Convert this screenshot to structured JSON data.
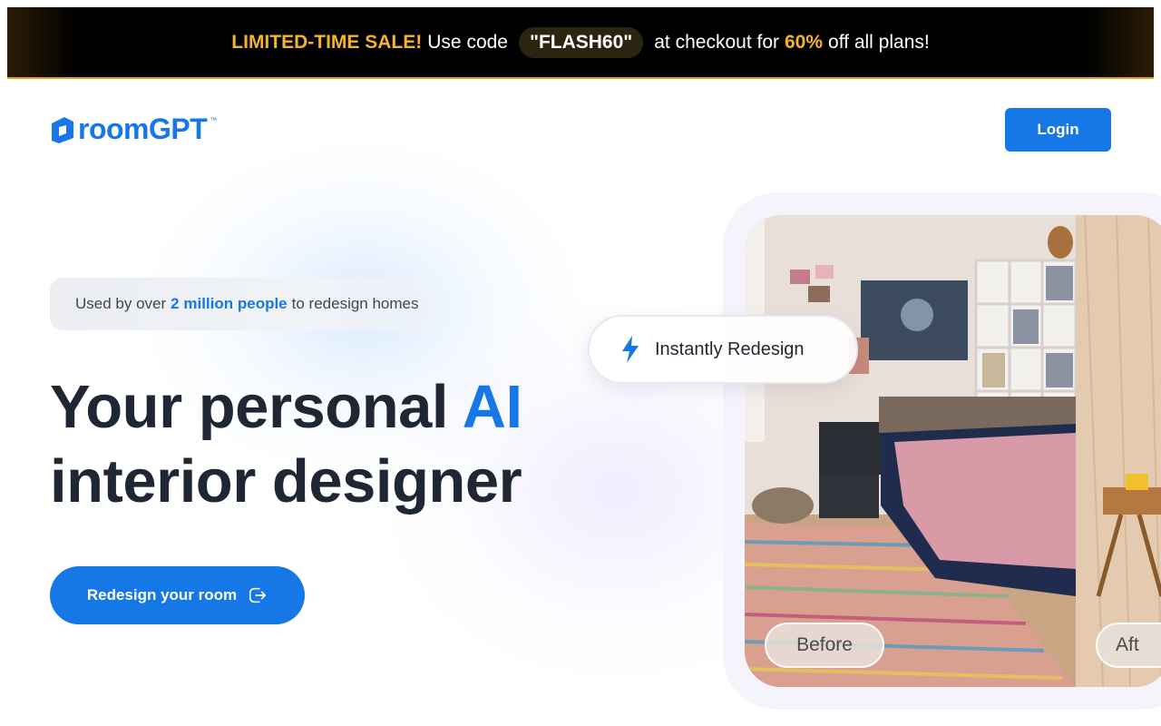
{
  "promo": {
    "sale": "LIMITED-TIME SALE!",
    "use_code": "Use code",
    "code": "\"FLASH60\"",
    "at_checkout": "at checkout for",
    "discount": "60%",
    "tail": "off all plans!"
  },
  "header": {
    "logo_text": "roomGPT",
    "logo_tm": "™",
    "login_label": "Login"
  },
  "hero": {
    "users_prefix": "Used by over",
    "users_highlight": "2 million people",
    "users_suffix": "to redesign homes",
    "headline_part1": "Your personal",
    "headline_ai": "AI",
    "headline_part2": "interior designer",
    "cta_label": "Redesign your room"
  },
  "showcase": {
    "instant_label": "Instantly Redesign",
    "before_label": "Before",
    "after_label": "Aft"
  },
  "colors": {
    "brand": "#1677e6",
    "promo_accent": "#f5b32c",
    "heading": "#1e2733"
  },
  "icons": {
    "logo": "house-logo-icon",
    "cta": "arrow-exit-icon",
    "instant": "lightning-bolt-icon"
  }
}
